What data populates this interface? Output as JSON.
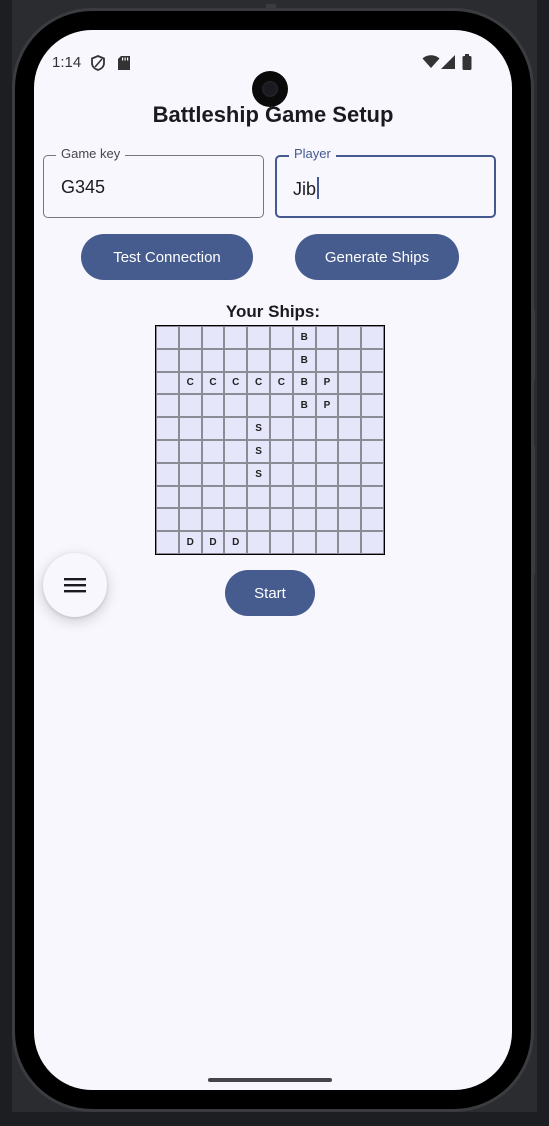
{
  "status_bar": {
    "time": "1:14"
  },
  "app": {
    "title": "Battleship Game Setup"
  },
  "form": {
    "game_key_label": "Game key",
    "game_key_value": "G345",
    "player_label": "Player",
    "player_value": "Jib"
  },
  "buttons": {
    "test_connection": "Test Connection",
    "generate_ships": "Generate Ships",
    "start": "Start"
  },
  "ships": {
    "title": "Your Ships:",
    "grid": [
      [
        "",
        "",
        "",
        "",
        "",
        "",
        "B",
        "",
        "",
        ""
      ],
      [
        "",
        "",
        "",
        "",
        "",
        "",
        "B",
        "",
        "",
        ""
      ],
      [
        "",
        "C",
        "C",
        "C",
        "C",
        "C",
        "B",
        "P",
        "",
        ""
      ],
      [
        "",
        "",
        "",
        "",
        "",
        "",
        "B",
        "P",
        "",
        ""
      ],
      [
        "",
        "",
        "",
        "",
        "S",
        "",
        "",
        "",
        "",
        ""
      ],
      [
        "",
        "",
        "",
        "",
        "S",
        "",
        "",
        "",
        "",
        ""
      ],
      [
        "",
        "",
        "",
        "",
        "S",
        "",
        "",
        "",
        "",
        ""
      ],
      [
        "",
        "",
        "",
        "",
        "",
        "",
        "",
        "",
        "",
        ""
      ],
      [
        "",
        "",
        "",
        "",
        "",
        "",
        "",
        "",
        "",
        ""
      ],
      [
        "",
        "D",
        "D",
        "D",
        "",
        "",
        "",
        "",
        "",
        ""
      ]
    ]
  },
  "icons": {
    "menu": "menu-icon",
    "status": [
      "shield-icon",
      "sd-card-icon",
      "wifi-icon",
      "signal-icon",
      "battery-icon"
    ]
  },
  "colors": {
    "accent": "#465b8e",
    "background": "#f8f7fd",
    "grid_cell": "#e6e6fa"
  }
}
